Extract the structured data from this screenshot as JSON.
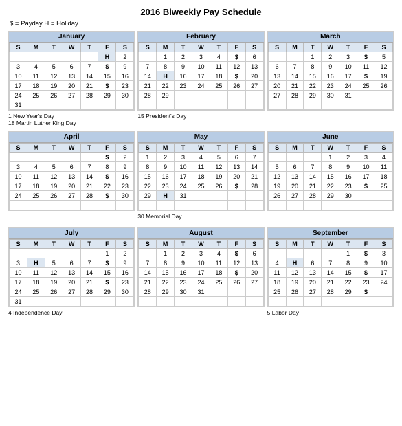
{
  "title": "2016 Biweekly Pay Schedule",
  "legend": "$ = Payday     H = Holiday",
  "months": [
    {
      "name": "January",
      "days": [
        "S",
        "M",
        "T",
        "W",
        "T",
        "F",
        "S"
      ],
      "rows": [
        [
          "",
          "",
          "",
          "",
          "",
          "H",
          "2"
        ],
        [
          "3",
          "4",
          "5",
          "6",
          "7",
          "$",
          "9"
        ],
        [
          "10",
          "11",
          "12",
          "13",
          "14",
          "15",
          "16"
        ],
        [
          "17",
          "18",
          "19",
          "20",
          "21",
          "$",
          "23"
        ],
        [
          "24",
          "25",
          "26",
          "27",
          "28",
          "29",
          "30"
        ],
        [
          "31",
          "",
          "",
          "",
          "",
          "",
          ""
        ]
      ],
      "notes": "1  New Year's Day\n18  Martin Luther King Day"
    },
    {
      "name": "February",
      "days": [
        "S",
        "M",
        "T",
        "W",
        "T",
        "F",
        "S"
      ],
      "rows": [
        [
          "",
          "1",
          "2",
          "3",
          "4",
          "$",
          "6"
        ],
        [
          "7",
          "8",
          "9",
          "10",
          "11",
          "12",
          "13"
        ],
        [
          "14",
          "H",
          "16",
          "17",
          "18",
          "$",
          "20"
        ],
        [
          "21",
          "22",
          "23",
          "24",
          "25",
          "26",
          "27"
        ],
        [
          "28",
          "29",
          "",
          "",
          "",
          "",
          ""
        ],
        [
          "",
          "",
          "",
          "",
          "",
          "",
          ""
        ]
      ],
      "notes": "15  President's Day"
    },
    {
      "name": "March",
      "days": [
        "S",
        "M",
        "T",
        "W",
        "T",
        "F",
        "S"
      ],
      "rows": [
        [
          "",
          "",
          "1",
          "2",
          "3",
          "$",
          "5"
        ],
        [
          "6",
          "7",
          "8",
          "9",
          "10",
          "11",
          "12"
        ],
        [
          "13",
          "14",
          "15",
          "16",
          "17",
          "$",
          "19"
        ],
        [
          "20",
          "21",
          "22",
          "23",
          "24",
          "25",
          "26"
        ],
        [
          "27",
          "28",
          "29",
          "30",
          "31",
          "",
          ""
        ],
        [
          "",
          "",
          "",
          "",
          "",
          "",
          ""
        ]
      ],
      "notes": ""
    },
    {
      "name": "April",
      "days": [
        "S",
        "M",
        "T",
        "W",
        "T",
        "F",
        "S"
      ],
      "rows": [
        [
          "",
          "",
          "",
          "",
          "",
          "$",
          "2"
        ],
        [
          "3",
          "4",
          "5",
          "6",
          "7",
          "8",
          "9"
        ],
        [
          "10",
          "11",
          "12",
          "13",
          "14",
          "$",
          "16"
        ],
        [
          "17",
          "18",
          "19",
          "20",
          "21",
          "22",
          "23"
        ],
        [
          "24",
          "25",
          "26",
          "27",
          "28",
          "$",
          "30"
        ],
        [
          "",
          "",
          "",
          "",
          "",
          "",
          ""
        ]
      ],
      "notes": ""
    },
    {
      "name": "May",
      "days": [
        "S",
        "M",
        "T",
        "W",
        "T",
        "F",
        "S"
      ],
      "rows": [
        [
          "1",
          "2",
          "3",
          "4",
          "5",
          "6",
          "7"
        ],
        [
          "8",
          "9",
          "10",
          "11",
          "12",
          "13",
          "14"
        ],
        [
          "15",
          "16",
          "17",
          "18",
          "19",
          "20",
          "21"
        ],
        [
          "22",
          "23",
          "24",
          "25",
          "26",
          "$",
          "28"
        ],
        [
          "29",
          "H",
          "31",
          "",
          "",
          "",
          ""
        ],
        [
          "",
          "",
          "",
          "",
          "",
          "",
          ""
        ]
      ],
      "notes": "30  Memorial Day"
    },
    {
      "name": "June",
      "days": [
        "S",
        "M",
        "T",
        "W",
        "T",
        "F",
        "S"
      ],
      "rows": [
        [
          "",
          "",
          "",
          "1",
          "2",
          "3",
          "4"
        ],
        [
          "5",
          "6",
          "7",
          "8",
          "9",
          "10",
          "11"
        ],
        [
          "12",
          "13",
          "14",
          "15",
          "16",
          "17",
          "18"
        ],
        [
          "19",
          "20",
          "21",
          "22",
          "23",
          "$",
          "25"
        ],
        [
          "26",
          "27",
          "28",
          "29",
          "30",
          "",
          ""
        ],
        [
          "",
          "",
          "",
          "",
          "",
          "",
          ""
        ]
      ],
      "notes": ""
    },
    {
      "name": "July",
      "days": [
        "S",
        "M",
        "T",
        "W",
        "T",
        "F",
        "S"
      ],
      "rows": [
        [
          "",
          "",
          "",
          "",
          "",
          "1",
          "2"
        ],
        [
          "3",
          "H",
          "5",
          "6",
          "7",
          "$",
          "9"
        ],
        [
          "10",
          "11",
          "12",
          "13",
          "14",
          "15",
          "16"
        ],
        [
          "17",
          "18",
          "19",
          "20",
          "21",
          "$",
          "23"
        ],
        [
          "24",
          "25",
          "26",
          "27",
          "28",
          "29",
          "30"
        ],
        [
          "31",
          "",
          "",
          "",
          "",
          "",
          ""
        ]
      ],
      "notes": "4  Independence Day"
    },
    {
      "name": "August",
      "days": [
        "S",
        "M",
        "T",
        "W",
        "T",
        "F",
        "S"
      ],
      "rows": [
        [
          "",
          "1",
          "2",
          "3",
          "4",
          "$",
          "6"
        ],
        [
          "7",
          "8",
          "9",
          "10",
          "11",
          "12",
          "13"
        ],
        [
          "14",
          "15",
          "16",
          "17",
          "18",
          "$",
          "20"
        ],
        [
          "21",
          "22",
          "23",
          "24",
          "25",
          "26",
          "27"
        ],
        [
          "28",
          "29",
          "30",
          "31",
          "",
          "",
          ""
        ],
        [
          "",
          "",
          "",
          "",
          "",
          "",
          ""
        ]
      ],
      "notes": ""
    },
    {
      "name": "September",
      "days": [
        "S",
        "M",
        "T",
        "W",
        "T",
        "F",
        "S"
      ],
      "rows": [
        [
          "",
          "",
          "",
          "",
          "1",
          "$",
          "3"
        ],
        [
          "4",
          "H",
          "6",
          "7",
          "8",
          "9",
          "10"
        ],
        [
          "11",
          "12",
          "13",
          "14",
          "15",
          "$",
          "17"
        ],
        [
          "18",
          "19",
          "20",
          "21",
          "22",
          "23",
          "24"
        ],
        [
          "25",
          "26",
          "27",
          "28",
          "29",
          "$",
          ""
        ],
        [
          "",
          "",
          "",
          "",
          "",
          "",
          ""
        ]
      ],
      "notes": "5  Labor Day"
    }
  ]
}
